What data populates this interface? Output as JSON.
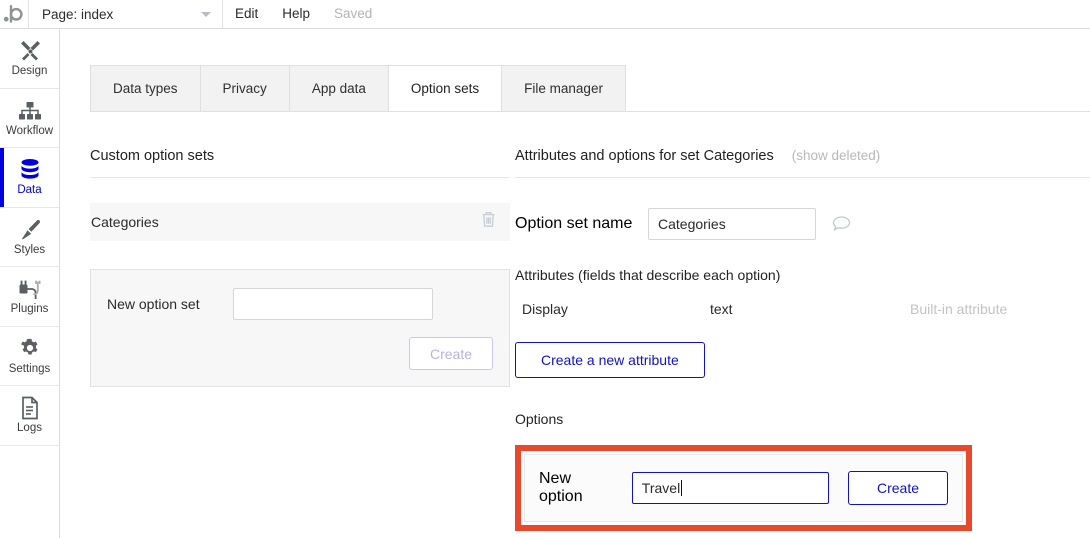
{
  "topbar": {
    "logo_icon": "bubble-logo",
    "page_label": "Page: index",
    "caret_icon": "chevron-down-icon",
    "menu": [
      {
        "label": "Edit",
        "muted": false
      },
      {
        "label": "Help",
        "muted": false
      },
      {
        "label": "Saved",
        "muted": true
      }
    ]
  },
  "sidebar": {
    "items": [
      {
        "label": "Design",
        "icon": "design-tools-icon",
        "active": false
      },
      {
        "label": "Workflow",
        "icon": "workflow-tree-icon",
        "active": false
      },
      {
        "label": "Data",
        "icon": "database-icon",
        "active": true
      },
      {
        "label": "Styles",
        "icon": "paintbrush-icon",
        "active": false
      },
      {
        "label": "Plugins",
        "icon": "plug-icon",
        "active": false
      },
      {
        "label": "Settings",
        "icon": "gear-icon",
        "active": false
      },
      {
        "label": "Logs",
        "icon": "document-lines-icon",
        "active": false
      }
    ],
    "active_color": "#0000e0"
  },
  "tabs": [
    {
      "label": "Data types",
      "active": false
    },
    {
      "label": "Privacy",
      "active": false
    },
    {
      "label": "App data",
      "active": false
    },
    {
      "label": "Option sets",
      "active": true
    },
    {
      "label": "File manager",
      "active": false
    }
  ],
  "left_panel": {
    "heading": "Custom option sets",
    "option_sets": [
      {
        "name": "Categories",
        "delete_icon": "trash-icon"
      }
    ],
    "new_set": {
      "label": "New option set",
      "value": "",
      "placeholder": "",
      "create_label": "Create",
      "create_disabled": true
    }
  },
  "right_panel": {
    "heading": "Attributes and options for set Categories",
    "show_deleted_label": "(show deleted)",
    "option_set_name": {
      "label": "Option set name",
      "value": "Categories",
      "comment_icon": "speech-bubble-icon"
    },
    "attributes": {
      "title": "Attributes (fields that describe each option)",
      "columns": [
        "Display",
        "text",
        "Built-in attribute"
      ],
      "create_attribute_label": "Create a new attribute"
    },
    "options": {
      "title": "Options",
      "new_option": {
        "label": "New option",
        "value": "Travel",
        "create_label": "Create",
        "focused": true
      },
      "highlight_color": "#E8482C"
    }
  }
}
